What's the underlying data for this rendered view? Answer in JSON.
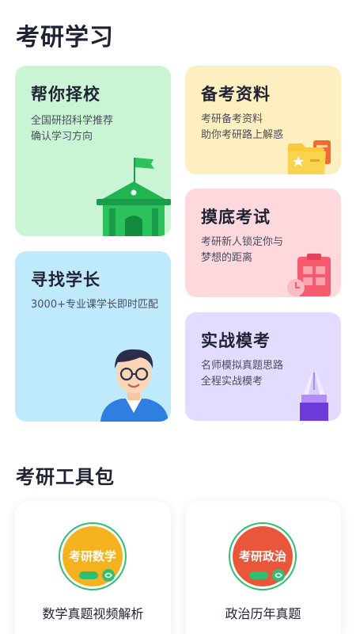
{
  "page": {
    "title": "考研学习"
  },
  "cards": {
    "school": {
      "title": "帮你择校",
      "desc_line1": "全国研招科学推荐",
      "desc_line2": "确认学习方向"
    },
    "materials": {
      "title": "备考资料",
      "desc_line1": "考研备考资料",
      "desc_line2": "助你考研路上解惑"
    },
    "mock": {
      "title": "摸底考试",
      "desc_line1": "考研新人锁定你与",
      "desc_line2": "梦想的距离"
    },
    "senior": {
      "title": "寻找学长",
      "desc_line1": "3000+专业课学长即时匹配"
    },
    "practice": {
      "title": "实战模考",
      "desc_line1": "名师模拟真题思路",
      "desc_line2": "全程实战模考"
    }
  },
  "toolkit": {
    "title": "考研工具包",
    "items": [
      {
        "badge_text": "考研数学",
        "badge_color": "#f6b21e",
        "label": "数学真题视频解析"
      },
      {
        "badge_text": "考研政治",
        "badge_color": "#e9563a",
        "label": "政治历年真题"
      }
    ]
  },
  "colors": {
    "green_card": "#c9f5d5",
    "blue_card": "#bfeafc",
    "yellow_card": "#fdefc0",
    "pink_card": "#fdd9de",
    "purple_card": "#e3dcff",
    "badge_ring": "#2fbf71"
  }
}
